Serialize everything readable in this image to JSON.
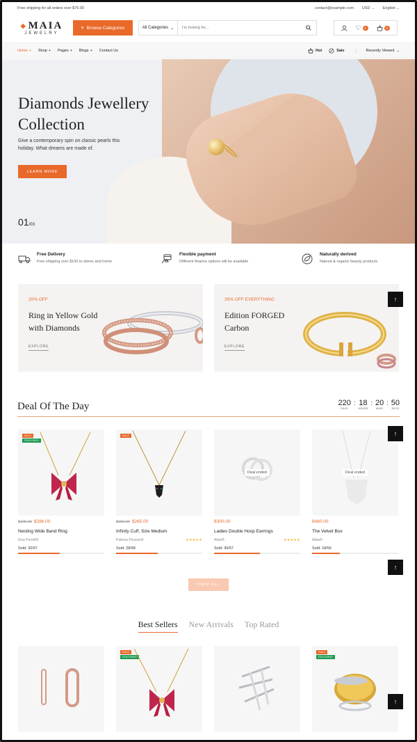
{
  "topbar": {
    "promo": "Free shipping for all orders over $75.00",
    "email": "contact@example.com",
    "currency": "USD",
    "language": "English"
  },
  "brand": {
    "name": "MAIA",
    "tagline": "JEWELRY",
    "accent": "#e8692a"
  },
  "header": {
    "browse_label": "Browse Categories",
    "category_select": "All Categories",
    "search_placeholder": "I'm looking for...",
    "wishlist_count": "0",
    "cart_count": "0"
  },
  "nav": {
    "items": [
      {
        "label": "Home",
        "active": true
      },
      {
        "label": "Shop"
      },
      {
        "label": "Pages"
      },
      {
        "label": "Blogs"
      },
      {
        "label": "Contact Us"
      }
    ],
    "hot": "Hot",
    "sale": "Sale",
    "recent": "Recently Viewed"
  },
  "hero": {
    "title": "Diamonds Jewellery Collection",
    "text": "Give a contemporary spin on classic pearls this holiday. What dreams are made of.",
    "button": "LEARN MORE",
    "slide_current": "01",
    "slide_total": "/03"
  },
  "features": [
    {
      "title": "Free Delivery",
      "text": "Free shipping over $100 to stores and home",
      "icon": "truck-icon"
    },
    {
      "title": "Flexible payment",
      "text": "Different finance options will be available",
      "icon": "card-hand-icon"
    },
    {
      "title": "Naturally derived",
      "text": "Natural & organic beauty products",
      "icon": "leaf-circle-icon"
    }
  ],
  "promos": [
    {
      "tag": "20% OFF",
      "title": "Ring in Yellow Gold with Diamonds",
      "link": "EXPLORE"
    },
    {
      "tag": "35% OFF EVERYTHING",
      "title": "Edition FORGED Carbon",
      "link": "EXPLORE"
    }
  ],
  "deal": {
    "title": "Deal Of The Day",
    "countdown": [
      {
        "value": "220",
        "unit": "DAYS"
      },
      {
        "value": "18",
        "unit": "HOURS"
      },
      {
        "value": "20",
        "unit": "MINS"
      },
      {
        "value": "50",
        "unit": "SECS"
      }
    ],
    "products": [
      {
        "old": "$305.00",
        "price": "$286.00",
        "name": "Nesting Wide Band Ring",
        "brand": "Elsa Peretti®",
        "sold": "Sold: 32/67",
        "progress": 0.48,
        "sale": "SALE",
        "featured": "FEATURED",
        "ended": "",
        "rating": ""
      },
      {
        "old": "$350.00",
        "price": "$265.00",
        "name": "Infinity Cuff, Size Medium",
        "brand": "Paloma Picasso®",
        "sold": "Sold: 28/58",
        "progress": 0.48,
        "sale": "SALE",
        "featured": "",
        "ended": "",
        "rating": "★★★★★"
      },
      {
        "old": "",
        "price": "$300.00",
        "name": "Ladies Double Hoop Earrings",
        "brand": "Atlas®",
        "sold": "Sold: 30/57",
        "progress": 0.53,
        "sale": "",
        "featured": "",
        "ended": "Deal ended",
        "rating": "★★★★★"
      },
      {
        "old": "",
        "price": "$460.00",
        "name": "The Velvet Box",
        "brand": "Atlas®",
        "sold": "Sold: 18/56",
        "progress": 0.32,
        "sale": "",
        "featured": "",
        "ended": "Deal ended",
        "rating": ""
      }
    ],
    "view_all": "VIEW ALL"
  },
  "tabs": [
    "Best Sellers",
    "New Arrivals",
    "Top Rated"
  ],
  "bestsellers": [
    {
      "sale": "",
      "featured": ""
    },
    {
      "sale": "SALE",
      "featured": "FEATURED"
    },
    {
      "sale": "",
      "featured": ""
    },
    {
      "sale": "SALE",
      "featured": "FEATURED"
    }
  ]
}
